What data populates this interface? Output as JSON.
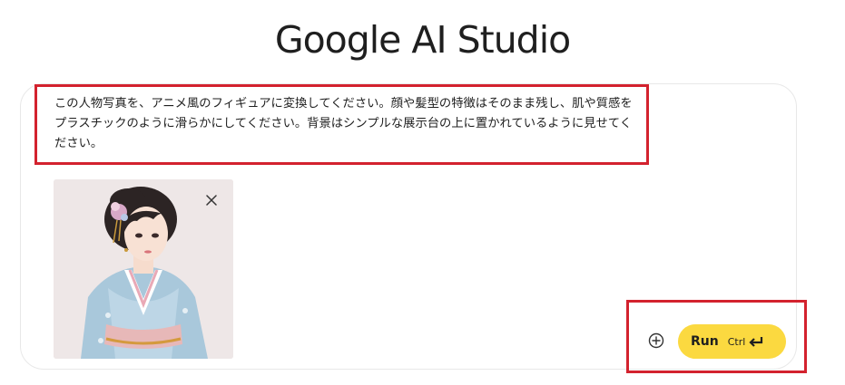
{
  "header": {
    "title": "Google AI Studio"
  },
  "prompt": {
    "text": "この人物写真を、アニメ風のフィギュアに変換してください。顔や髪型の特徴はそのまま残し、肌や質感をプラスチックのように滑らかにしてください。背景はシンプルな展示台の上に置かれているように見せてください。"
  },
  "attachment": {
    "remove_icon": "close-icon"
  },
  "actions": {
    "add_icon": "plus-circle-icon",
    "run_label": "Run",
    "run_shortcut": "Ctrl",
    "enter_icon": "enter-arrow-icon",
    "run_color": "#fbd940"
  },
  "annotations": {
    "highlight_color": "#d3222e"
  }
}
